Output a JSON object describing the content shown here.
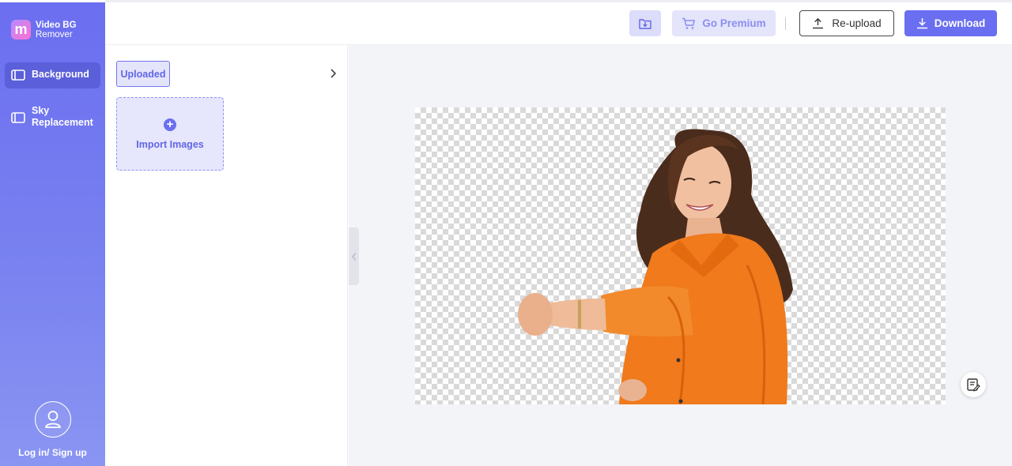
{
  "app": {
    "logo_line1": "Video BG",
    "logo_line2": "Remover",
    "logo_glyph": "m"
  },
  "sidebar": {
    "items": [
      {
        "label": "Background",
        "icon": "video-icon",
        "active": true
      },
      {
        "label": "Sky Replacement",
        "icon": "video-icon",
        "active": false
      }
    ],
    "login_label": "Log in/ Sign up"
  },
  "toolbar": {
    "save_icon": "download-to-folder-icon",
    "premium_label": "Go Premium",
    "reupload_label": "Re-upload",
    "download_label": "Download"
  },
  "panel": {
    "tab_label": "Uploaded",
    "import_label": "Import Images"
  },
  "colors": {
    "accent": "#6a6ef0",
    "accent_light": "#e4e4fb",
    "sidebar_top": "#6b6ef0",
    "sidebar_bottom": "#8a95f2",
    "shirt_orange": "#f07a1c"
  }
}
